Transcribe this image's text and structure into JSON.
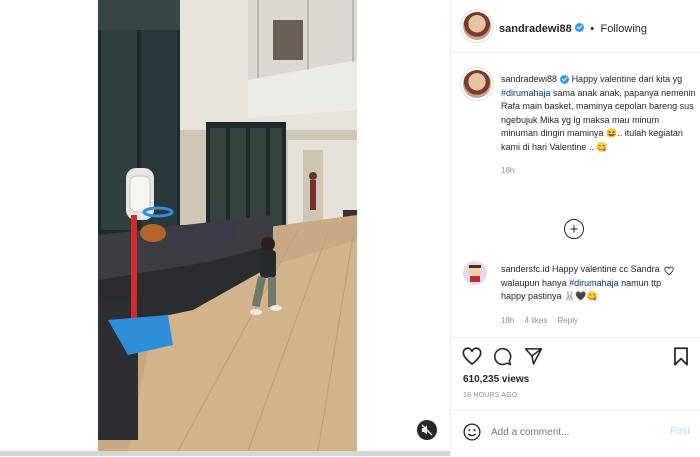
{
  "header": {
    "username": "sandradewi88",
    "separator": "•",
    "follow_status": "Following"
  },
  "caption": {
    "username": "sandradewi88",
    "text_1": "Happy valentine dari kita yg",
    "hashtag": "#dirumahaja",
    "text_2": "sama anak anak, papanya nemenin Rafa main basket, maminya cepolan bareng sus ngebujuk Mika yg lg maksa mau minum minuman dingin maminya",
    "emoji_1": "😆",
    "text_3": ".. itulah kegiatan kami di hari Valentine ..",
    "emoji_2": "😋",
    "time": "18h"
  },
  "load_more_symbol": "+",
  "comment": {
    "username": "sandersfc.id",
    "text_1": "Happy valentine cc Sandra walaupun hanya",
    "hashtag": "#dirumahaja",
    "text_2": "namun ttp happy pastinya",
    "emojis": "🐰🖤😋",
    "time": "18h",
    "likes": "4 likes",
    "reply": "Reply"
  },
  "post": {
    "views": "610,235 views",
    "timestamp": "18 HOURS AGO"
  },
  "add_comment": {
    "placeholder": "Add a comment...",
    "post_label": "Post"
  },
  "icons": {
    "like": "heart-icon",
    "comment": "comment-icon",
    "share": "paper-plane-icon",
    "save": "bookmark-icon",
    "mute": "speaker-muted-icon",
    "emoji": "smiley-icon",
    "verified": "verified-badge-icon",
    "load_more": "plus-circle-icon"
  },
  "colors": {
    "link": "#00376b",
    "verified": "#3897f0",
    "muted_text": "#8e8e8e",
    "post_disabled": "#b2dffc"
  }
}
